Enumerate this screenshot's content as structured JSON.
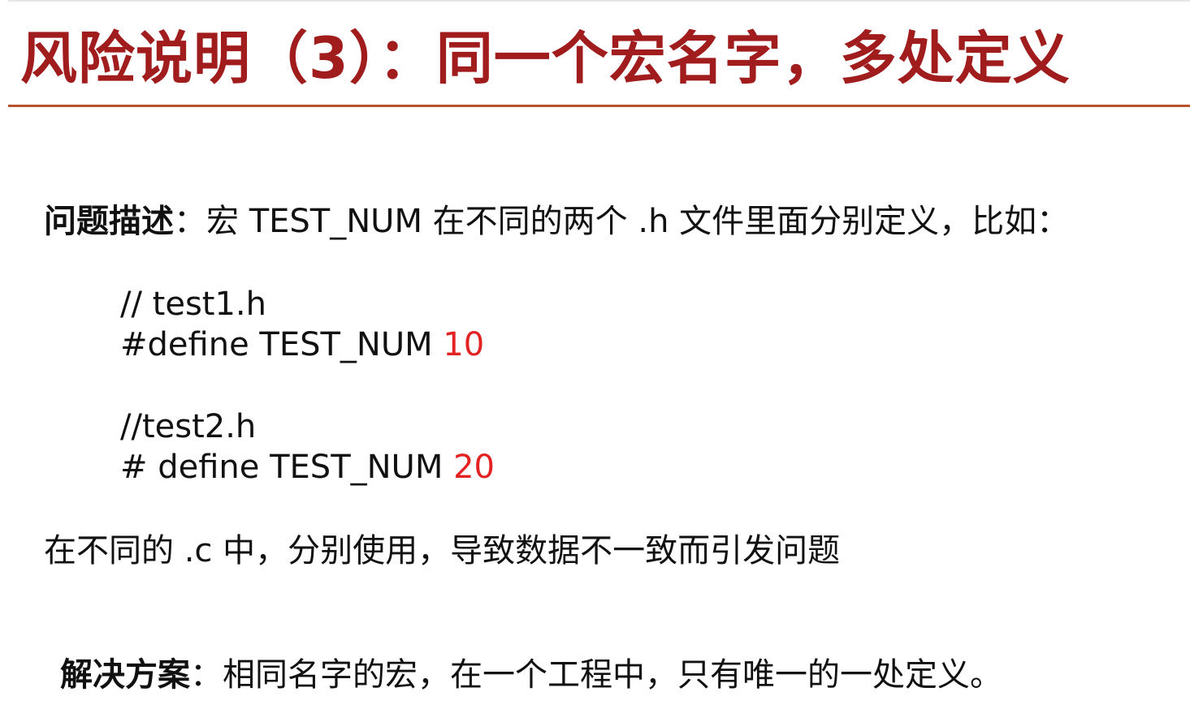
{
  "slide": {
    "title": "风险说明（3）：同一个宏名字，多处定义",
    "problem": {
      "label": "问题描述",
      "colon": "：",
      "text": "宏 TEST_NUM 在不同的两个 .h 文件里面分别定义，比如："
    },
    "code": [
      {
        "comment": "// test1.h",
        "define_prefix": "#define TEST_NUM ",
        "value": "10"
      },
      {
        "comment": "//test2.h",
        "define_prefix": "# define TEST_NUM ",
        "value": "20"
      }
    ],
    "effect": "在不同的 .c 中，分别使用，导致数据不一致而引发问题",
    "solution": {
      "label": "解决方案",
      "colon": "：",
      "text": "相同名字的宏，在一个工程中，只有唯一的一处定义。"
    },
    "colors": {
      "title": "#a11d1d",
      "rule": "#b4532a",
      "highlight": "#e32222",
      "text": "#111111"
    }
  }
}
